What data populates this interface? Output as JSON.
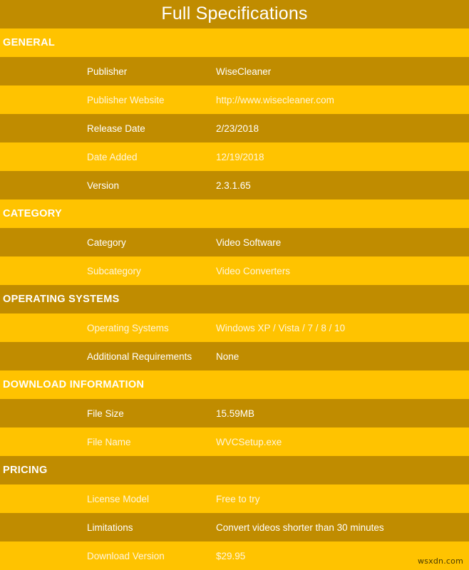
{
  "page": {
    "title": "Full Specifications",
    "watermark": "wsxdn.com",
    "colors": {
      "band_dark": "#C08C00",
      "band_light": "#FFC300",
      "text": "#FFFFFF"
    }
  },
  "rows": [
    {
      "kind": "section",
      "label": "GENERAL",
      "shade": "light"
    },
    {
      "kind": "data",
      "label": "Publisher",
      "value": "WiseCleaner",
      "shade": "dark"
    },
    {
      "kind": "data",
      "label": "Publisher Website",
      "value": "http://www.wisecleaner.com",
      "shade": "light"
    },
    {
      "kind": "data",
      "label": "Release Date",
      "value": "2/23/2018",
      "shade": "dark"
    },
    {
      "kind": "data",
      "label": "Date Added",
      "value": "12/19/2018",
      "shade": "light"
    },
    {
      "kind": "data",
      "label": "Version",
      "value": "2.3.1.65",
      "shade": "dark"
    },
    {
      "kind": "section",
      "label": "CATEGORY",
      "shade": "light"
    },
    {
      "kind": "data",
      "label": "Category",
      "value": "Video Software",
      "shade": "dark"
    },
    {
      "kind": "data",
      "label": "Subcategory",
      "value": "Video Converters",
      "shade": "light"
    },
    {
      "kind": "section",
      "label": "OPERATING SYSTEMS",
      "shade": "dark"
    },
    {
      "kind": "data",
      "label": "Operating Systems",
      "value": "Windows XP / Vista / 7 / 8 / 10",
      "shade": "light"
    },
    {
      "kind": "data",
      "label": "Additional Requirements",
      "value": "None",
      "shade": "dark"
    },
    {
      "kind": "section",
      "label": "DOWNLOAD INFORMATION",
      "shade": "light"
    },
    {
      "kind": "data",
      "label": "File Size",
      "value": "15.59MB",
      "shade": "dark"
    },
    {
      "kind": "data",
      "label": "File Name",
      "value": "WVCSetup.exe",
      "shade": "light"
    },
    {
      "kind": "section",
      "label": "PRICING",
      "shade": "dark"
    },
    {
      "kind": "data",
      "label": "License Model",
      "value": "Free to try",
      "shade": "light"
    },
    {
      "kind": "data",
      "label": "Limitations",
      "value": "Convert videos shorter than 30 minutes",
      "shade": "dark"
    },
    {
      "kind": "data",
      "label": "Download Version",
      "value": "$29.95",
      "shade": "light"
    }
  ]
}
